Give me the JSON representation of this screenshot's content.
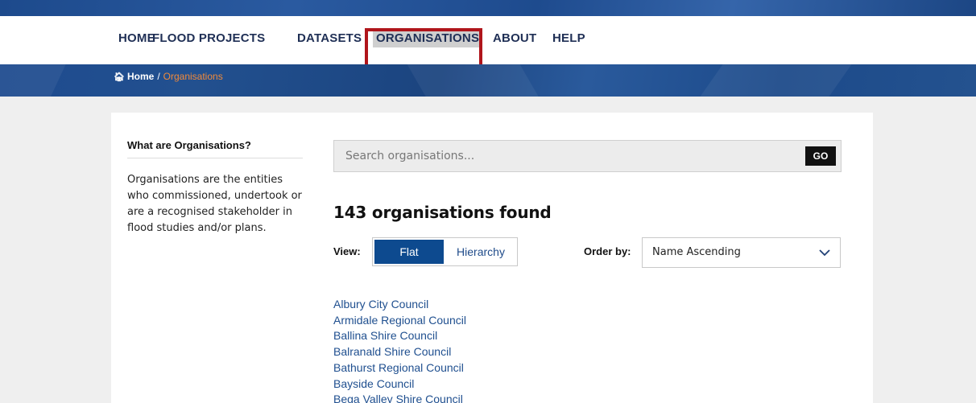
{
  "nav": {
    "items": [
      {
        "label": "HOME"
      },
      {
        "label": "FLOOD PROJECTS"
      },
      {
        "label": "DATASETS"
      },
      {
        "label": "ORGANISATIONS",
        "active": true
      },
      {
        "label": "ABOUT"
      },
      {
        "label": "HELP"
      }
    ]
  },
  "breadcrumb": {
    "home_icon": "home-icon",
    "home": "Home",
    "separator": "/",
    "current": "Organisations"
  },
  "sidebar": {
    "title": "What are Organisations?",
    "text": "Organisations are the entities who commissioned, undertook or are a recognised stakeholder in flood studies and/or plans."
  },
  "search": {
    "placeholder": "Search organisations...",
    "button": "GO"
  },
  "results": {
    "count_text": "143 organisations found"
  },
  "view": {
    "label": "View:",
    "options": [
      "Flat",
      "Hierarchy"
    ],
    "selected": "Flat"
  },
  "order": {
    "label": "Order by:",
    "selected": "Name Ascending"
  },
  "organisations": [
    "Albury City Council",
    "Armidale Regional Council",
    "Ballina Shire Council",
    "Balranald Shire Council",
    "Bathurst Regional Council",
    "Bayside Council",
    "Bega Valley Shire Council"
  ],
  "colors": {
    "nav_text": "#1f2f55",
    "band": "#1e4b8f",
    "breadcrumb_current": "#f28a3a",
    "active_toggle": "#0d4a8f",
    "link": "#1f4f8f",
    "highlight": "#b0151b"
  }
}
